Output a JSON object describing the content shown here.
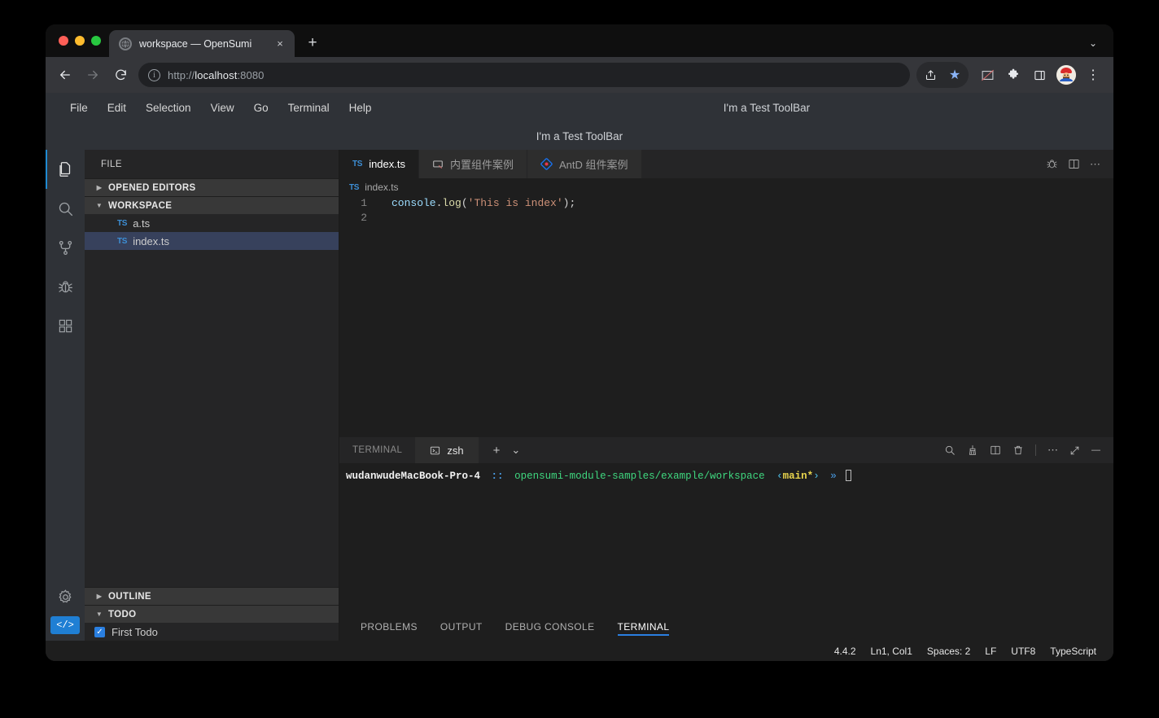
{
  "browser": {
    "tab": {
      "title": "workspace — OpenSumi",
      "favicon": "globe-icon",
      "close": "×"
    },
    "new_tab_label": "+",
    "tabstrip_caret": "⌄",
    "nav": {
      "back": "←",
      "forward": "→",
      "reload": "⟳"
    },
    "omnibox": {
      "info_icon": "i",
      "url_scheme": "http://",
      "url_host": "localhost",
      "url_rest": ":8080"
    },
    "icons": {
      "share": "share-icon",
      "bookmark_star": "★",
      "broken_heart": "broken-image-icon",
      "extensions": "puzzle-icon",
      "side_panel": "side-panel-icon",
      "profile": "mario-avatar",
      "menu": "⋮"
    }
  },
  "ide": {
    "menubar": [
      "File",
      "Edit",
      "Selection",
      "View",
      "Go",
      "Terminal",
      "Help"
    ],
    "menubar_toolbar_text": "I'm a Test ToolBar",
    "toolbar_row_text": "I'm a Test ToolBar",
    "activitybar": [
      {
        "name": "explorer",
        "icon": "files-icon",
        "active": true
      },
      {
        "name": "search",
        "icon": "search-icon",
        "active": false
      },
      {
        "name": "source-control",
        "icon": "branch-icon",
        "active": false
      },
      {
        "name": "debug",
        "icon": "bug-icon",
        "active": false
      },
      {
        "name": "extensions",
        "icon": "grid-icon",
        "active": false
      }
    ],
    "activitybar_bottom": [
      {
        "name": "settings",
        "icon": "gear-icon"
      },
      {
        "name": "code-badge",
        "label": "</>"
      }
    ],
    "sidebar": {
      "title": "FILE",
      "sections": [
        {
          "label": "OPENED EDITORS",
          "expanded": false
        },
        {
          "label": "WORKSPACE",
          "expanded": true
        }
      ],
      "files": [
        {
          "icon": "TS",
          "name": "a.ts",
          "selected": false
        },
        {
          "icon": "TS",
          "name": "index.ts",
          "selected": true
        }
      ],
      "outline": {
        "label": "OUTLINE",
        "expanded": false
      },
      "todo": {
        "label": "TODO",
        "expanded": true
      },
      "todo_items": [
        {
          "label": "First Todo",
          "checked": true
        }
      ]
    },
    "editor": {
      "tabs": [
        {
          "label": "index.ts",
          "icon": "TS",
          "active": true
        },
        {
          "label": "内置组件案例",
          "icon": "component-icon",
          "active": false
        },
        {
          "label": "AntD 组件案例",
          "icon": "antd-icon",
          "active": false
        }
      ],
      "actions": {
        "debug": "bug-icon",
        "split": "split-editor-icon",
        "more": "⋯"
      },
      "breadcrumb": {
        "icon": "TS",
        "label": "index.ts"
      },
      "code": {
        "lines": [
          {
            "no": "1",
            "obj": "console",
            "dot": ".",
            "fn": "log",
            "open": "(",
            "str": "'This is index'",
            "close": ");"
          },
          {
            "no": "2",
            "obj": "",
            "dot": "",
            "fn": "",
            "open": "",
            "str": "",
            "close": ""
          }
        ]
      }
    },
    "panel": {
      "terminal_label": "TERMINAL",
      "terminal_tab": {
        "label": "zsh",
        "icon": "terminal-icon"
      },
      "add_icon": "+",
      "add_caret": "⌄",
      "actions": {
        "search": "search-icon",
        "clear": "broom-icon",
        "split": "split-icon",
        "kill": "trash-icon",
        "more": "⋯",
        "maximize": "maximize-icon",
        "minimize": "—"
      },
      "prompt": {
        "host": "wudanwudeMacBook-Pro-4",
        "separator": "::",
        "path": "opensumi-module-samples/example/workspace",
        "branch_open": "‹",
        "branch": "main*",
        "branch_close": "›",
        "symbol": "»"
      },
      "tabs": [
        {
          "label": "PROBLEMS",
          "active": false
        },
        {
          "label": "OUTPUT",
          "active": false
        },
        {
          "label": "DEBUG CONSOLE",
          "active": false
        },
        {
          "label": "TERMINAL",
          "active": true
        }
      ]
    },
    "statusbar": [
      "4.4.2",
      "Ln1, Col1",
      "Spaces: 2",
      "LF",
      "UTF8",
      "TypeScript"
    ]
  },
  "colors": {
    "accent": "#2a7fe0",
    "ts_blue": "#3d8fd6",
    "selection": "#37415c",
    "terminal_green": "#3fd77f",
    "terminal_yellow": "#e8d44d"
  }
}
